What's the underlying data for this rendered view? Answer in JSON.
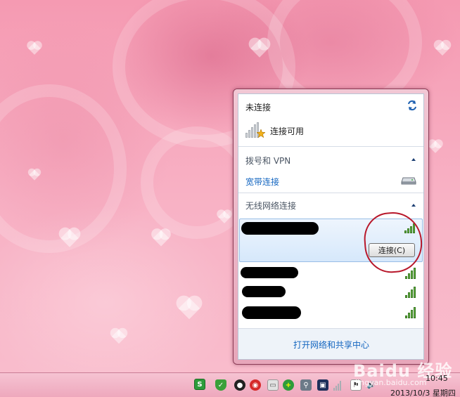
{
  "flyout": {
    "status_title": "未连接",
    "connection_status": "连接可用",
    "dialup_section_title": "拨号和 VPN",
    "broadband_link": "宽带连接",
    "wireless_section_title": "无线网络连接",
    "connect_button": "连接(C)",
    "networks": [
      {
        "name": "",
        "signal_bars": 4,
        "selected": true
      },
      {
        "name": "",
        "signal_bars": 4,
        "selected": false
      },
      {
        "name": "",
        "signal_bars": 4,
        "selected": false
      },
      {
        "name": "",
        "signal_bars": 4,
        "selected": false
      }
    ],
    "footer_link": "打开网络和共享中心"
  },
  "taskbar": {
    "time": "10:45",
    "date": "2013/10/3 星期四"
  },
  "watermark": {
    "logo": "Baidu 经验",
    "url": "jingyan.baidu.com"
  },
  "colors": {
    "link_blue": "#1466c0",
    "signal_green": "#63b043",
    "annotation_red": "#b8182b",
    "desktop_pink": "#f59ab2"
  }
}
